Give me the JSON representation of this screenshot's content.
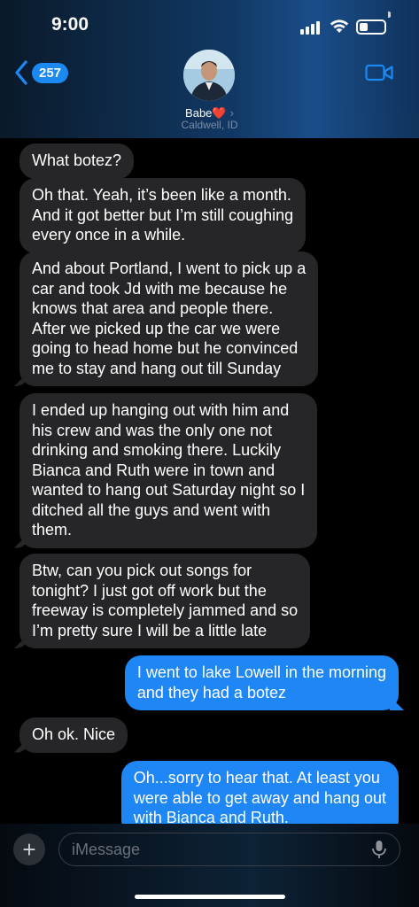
{
  "status": {
    "time": "9:00",
    "battery_level": 0.35
  },
  "header": {
    "back_count": "257",
    "contact_name": "Babe",
    "contact_heart": "❤️",
    "contact_location": "Caldwell, ID"
  },
  "messages": [
    {
      "dir": "in",
      "text": "What botez?"
    },
    {
      "dir": "in",
      "text": "Oh that. Yeah, it’s been like a month.\nAnd it got better but I’m still coughing\nevery once in a while."
    },
    {
      "dir": "in",
      "text": "And about Portland, I went to pick up a\ncar and took Jd with me because he\nknows that area and people there.\nAfter we picked up the car we were\ngoing to head home but he convinced\nme to stay and hang out till Sunday"
    },
    {
      "dir": "in",
      "text": "I ended up hanging out with him and\nhis crew and was the only one not\ndrinking and smoking there. Luckily\nBianca and Ruth were in town and\nwanted to hang out Saturday night so I\nditched all the guys and went with\nthem."
    },
    {
      "dir": "in",
      "text": "Btw, can you pick out songs for\ntonight? I just got off work but the\nfreeway is completely jammed and so\nI’m pretty sure I will be a little late"
    },
    {
      "dir": "out",
      "text": "I went to lake Lowell in the morning\nand they had a botez"
    },
    {
      "dir": "in",
      "text": "Oh ok. Nice"
    },
    {
      "dir": "out",
      "text": "Oh...sorry to hear that. At least you\nwere able to get away and hang out\nwith Bianca and Ruth."
    }
  ],
  "composer": {
    "placeholder": "iMessage",
    "value": ""
  }
}
